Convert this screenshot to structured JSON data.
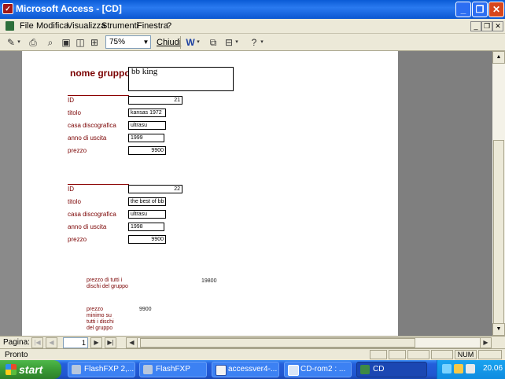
{
  "window": {
    "title": "Microsoft Access - [CD]"
  },
  "menu": {
    "items": [
      "File",
      "Modifica",
      "Visualizza",
      "Strumenti",
      "Finestra",
      "?"
    ]
  },
  "toolbar": {
    "zoom": "75%",
    "close_label": "Chiudi"
  },
  "report": {
    "group_label": "nome gruppo",
    "group_value": "bb king",
    "records": [
      {
        "id_label": "ID",
        "id": "21",
        "titolo_label": "titolo",
        "titolo": "kansas 1972",
        "casa_label": "casa discografica",
        "casa": "ultrasu",
        "anno_label": "anno di uscita",
        "anno": "1999",
        "prezzo_label": "prezzo",
        "prezzo": "9900"
      },
      {
        "id_label": "ID",
        "id": "22",
        "titolo_label": "titolo",
        "titolo": "the best of bb kin",
        "casa_label": "casa discografica",
        "casa": "ultrasu",
        "anno_label": "anno di uscita",
        "anno": "1998",
        "prezzo_label": "prezzo",
        "prezzo": "9900"
      }
    ],
    "summary": {
      "total_label": "prezzo di tutti i dischi del gruppo",
      "total": "19800",
      "min_label": "prezzo minimo su tutti i dischi del gruppo",
      "min": "9900"
    }
  },
  "navigation": {
    "label": "Pagina:",
    "page": "1"
  },
  "status": {
    "text": "Pronto",
    "num": "NUM"
  },
  "taskbar": {
    "start": "start",
    "items": [
      {
        "label": "FlashFXP 2,...",
        "icon": "flashfxp-icon"
      },
      {
        "label": "FlashFXP",
        "icon": "flashfxp-icon"
      },
      {
        "label": "accessver4-...",
        "icon": "word-icon"
      },
      {
        "label": "CD-rom2 : ...",
        "icon": "access-window-icon"
      },
      {
        "label": "CD",
        "icon": "access-report-icon"
      }
    ],
    "clock": "20.06"
  }
}
